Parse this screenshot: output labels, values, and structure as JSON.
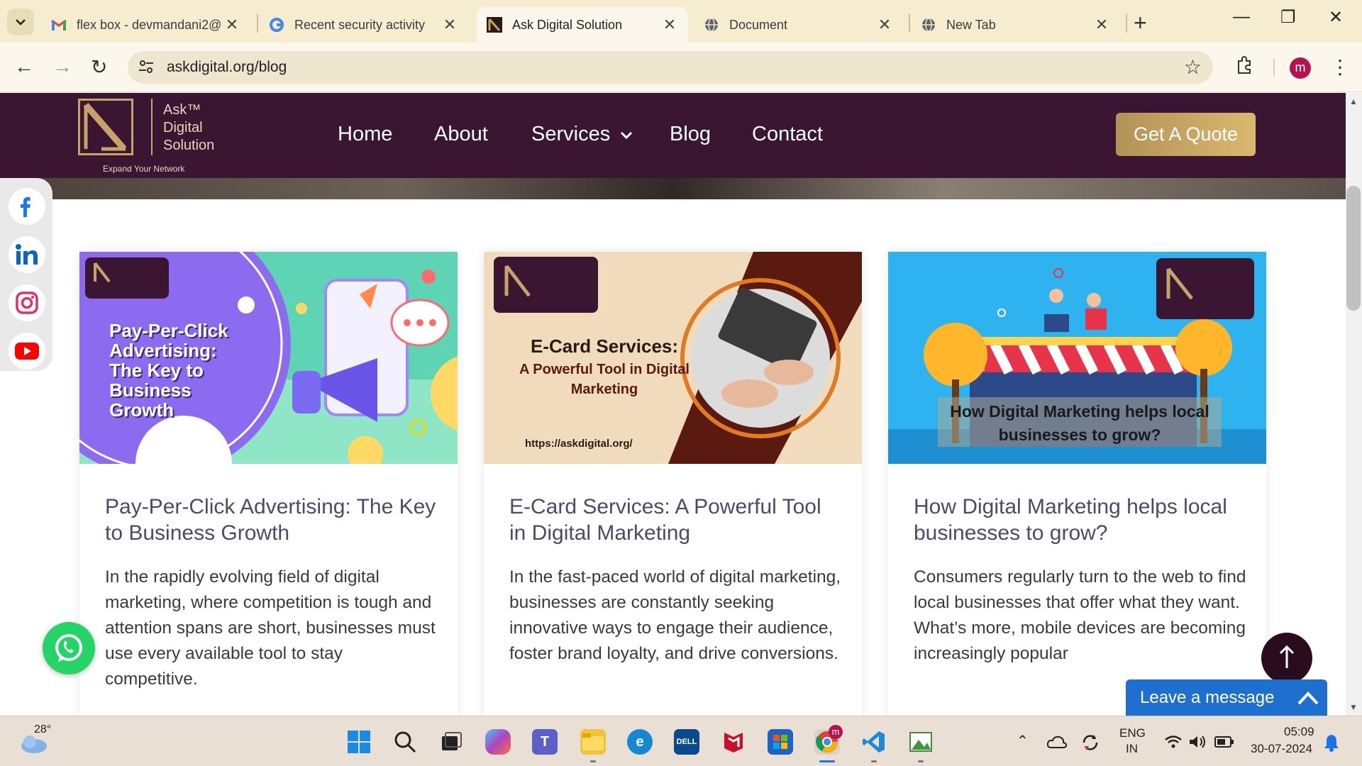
{
  "browser": {
    "tabs": [
      {
        "label": "flex box - devmandani2@",
        "icon": "gmail-icon",
        "active": false
      },
      {
        "label": "Recent security activity",
        "icon": "google-icon",
        "active": false
      },
      {
        "label": "Ask Digital Solution",
        "icon": "site-logo-icon",
        "active": true
      },
      {
        "label": "Document",
        "icon": "globe-icon",
        "active": false
      },
      {
        "label": "New Tab",
        "icon": "globe-icon",
        "active": false
      }
    ],
    "url": "askdigital.org/blog",
    "profile_initial": "m"
  },
  "site": {
    "logo": {
      "line1": "Ask™",
      "line2": "Digital",
      "line3": "Solution",
      "tagline": "Expand Your Network"
    },
    "nav": [
      "Home",
      "About",
      "Services",
      "Blog",
      "Contact"
    ],
    "quote_button": "Get A Quote"
  },
  "posts": [
    {
      "image_text": "Pay-Per-Click Advertising: The Key to Business Growth",
      "title": "Pay-Per-Click Advertising: The Key to Business Growth",
      "excerpt": "In the rapidly evolving field of digital marketing, where competition is tough and attention spans are short, businesses must use every available tool to stay competitive."
    },
    {
      "image_text": "E-Card Services:",
      "image_sub": "A Powerful Tool in Digital Marketing",
      "image_url": "https://askdigital.org/",
      "title": "E-Card Services: A Powerful Tool in Digital Marketing",
      "excerpt": "In the fast-paced world of digital marketing, businesses are constantly seeking innovative ways to engage their audience, foster brand loyalty, and drive conversions."
    },
    {
      "image_text": "How Digital Marketing helps local businesses to grow?",
      "title": "How Digital Marketing helps local businesses to grow?",
      "excerpt": "Consumers regularly turn to the web to find local businesses that offer what they want. What’s more, mobile devices are becoming increasingly popular"
    }
  ],
  "widgets": {
    "leave_message": "Leave a message"
  },
  "taskbar": {
    "weather": "28°",
    "lang1": "ENG",
    "lang2": "IN",
    "time": "05:09",
    "date": "30-07-2024"
  },
  "colors": {
    "header_bg": "#3a1632",
    "accent_gold": "#c7a26a",
    "title_purple": "#534769",
    "chat_blue": "#1f6fd1"
  }
}
